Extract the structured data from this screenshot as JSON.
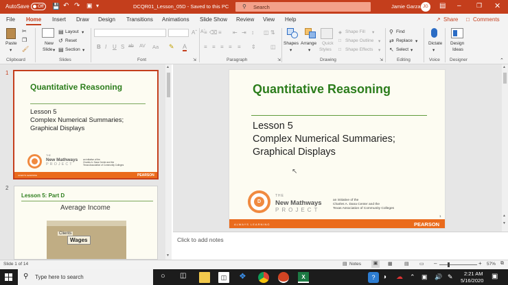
{
  "titlebar": {
    "autosave_label": "AutoSave",
    "autosave_state": "Off",
    "document_title": "DCQR01_Lesson_05D  -  Saved to this PC",
    "search_placeholder": "Search",
    "user_name": "Jamie Garza",
    "user_initials": "JG"
  },
  "tabs": [
    "File",
    "Home",
    "Insert",
    "Draw",
    "Design",
    "Transitions",
    "Animations",
    "Slide Show",
    "Review",
    "View",
    "Help"
  ],
  "share_label": "Share",
  "comments_label": "Comments",
  "ribbon": {
    "clipboard": {
      "paste": "Paste",
      "label": "Clipboard"
    },
    "slides": {
      "new_slide_1": "New",
      "new_slide_2": "Slide",
      "layout": "Layout",
      "reset": "Reset",
      "section": "Section",
      "label": "Slides"
    },
    "font": {
      "label": "Font",
      "bold": "B",
      "italic": "I",
      "underline": "U",
      "strike": "S",
      "shadow": "ab",
      "spacing": "AV",
      "case": "Aa",
      "color": "A"
    },
    "paragraph": {
      "label": "Paragraph"
    },
    "drawing": {
      "shapes": "Shapes",
      "arrange": "Arrange",
      "quick_styles_1": "Quick",
      "quick_styles_2": "Styles",
      "shape_fill": "Shape Fill",
      "shape_outline": "Shape Outline",
      "shape_effects": "Shape Effects",
      "label": "Drawing"
    },
    "editing": {
      "find": "Find",
      "replace": "Replace",
      "select": "Select",
      "label": "Editing"
    },
    "voice": {
      "dictate": "Dictate",
      "label": "Voice"
    },
    "designer": {
      "ideas_1": "Design",
      "ideas_2": "Ideas",
      "label": "Designer"
    }
  },
  "slide1": {
    "number": "1",
    "title": "Quantitative Reasoning",
    "line1": "Lesson 5",
    "line2": "Complex Numerical Summaries;",
    "line3": "Graphical Displays",
    "logo_the": "THE",
    "logo_new": "New Mathways",
    "logo_project": "PROJECT",
    "initiative_1": "an initiative of the",
    "initiative_2": "Charles A. Dana Center and the",
    "initiative_3": "Texas Association of Community Colleges",
    "footer_left": "ALWAYS LEARNING",
    "footer_right": "PEARSON",
    "page": "1"
  },
  "slide2": {
    "number": "2",
    "header": "Lesson 5: Part D",
    "title": "Average Income",
    "image_text_1": "Clients",
    "image_text_2": "Wages"
  },
  "notes_placeholder": "Click to add notes",
  "status": {
    "slide_counter": "Slide 1 of 14",
    "notes": "Notes",
    "zoom": "57%"
  },
  "taskbar": {
    "search_placeholder": "Type here to search",
    "time": "2:21 AM",
    "date": "5/16/2020"
  },
  "colors": {
    "accent": "#c43e1c",
    "green": "#2c7d1c",
    "orange": "#ea6b1c"
  }
}
